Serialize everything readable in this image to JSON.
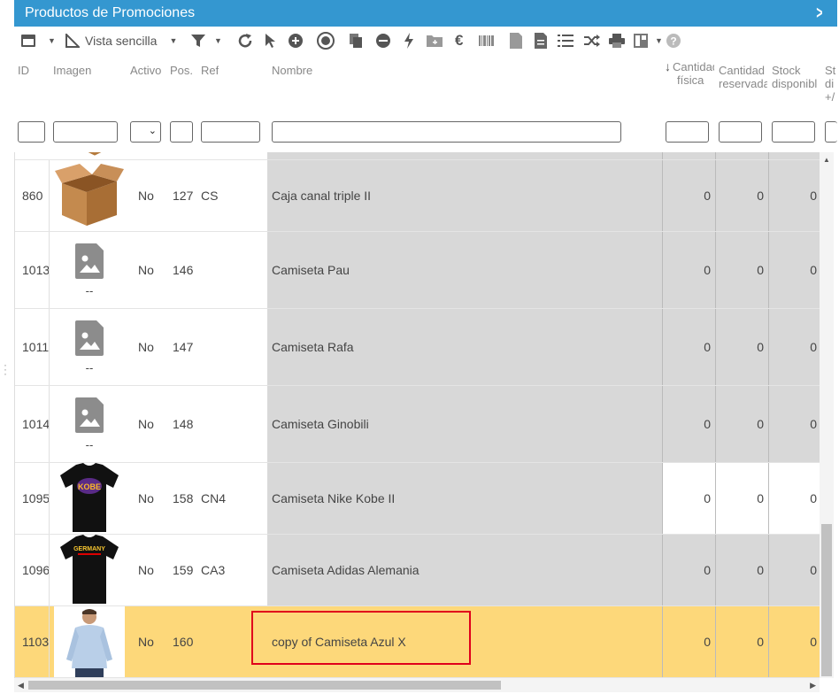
{
  "window": {
    "title": "Productos de Promociones"
  },
  "toolbar": {
    "view_label": "Vista sencilla"
  },
  "columns": {
    "id": "ID",
    "imagen": "Imagen",
    "activo": "Activo",
    "pos": "Pos.",
    "ref": "Ref",
    "nombre": "Nombre",
    "cant_fisica_1": "Cantidad",
    "cant_fisica_2": "física",
    "cant_res_1": "Cantidad",
    "cant_res_2": "reservada",
    "stock_disp_1": "Stock",
    "stock_disp_2": "disponible",
    "stock_x_1": "St",
    "stock_x_2": "di",
    "stock_x_3": "+/"
  },
  "rows": [
    {
      "id": "860",
      "activo": "No",
      "pos": "127",
      "ref": "CS",
      "nombre": "Caja canal triple II",
      "fisica": "0",
      "reservada": "0",
      "disponible": "0",
      "image": "box"
    },
    {
      "id": "1013",
      "activo": "No",
      "pos": "146",
      "ref": "",
      "nombre": "Camiseta Pau",
      "fisica": "0",
      "reservada": "0",
      "disponible": "0",
      "image": "placeholder",
      "image_caption": "--"
    },
    {
      "id": "1011",
      "activo": "No",
      "pos": "147",
      "ref": "",
      "nombre": "Camiseta Rafa",
      "fisica": "0",
      "reservada": "0",
      "disponible": "0",
      "image": "placeholder",
      "image_caption": "--"
    },
    {
      "id": "1014",
      "activo": "No",
      "pos": "148",
      "ref": "",
      "nombre": "Camiseta Ginobili",
      "fisica": "0",
      "reservada": "0",
      "disponible": "0",
      "image": "placeholder",
      "image_caption": "--"
    },
    {
      "id": "1095",
      "activo": "No",
      "pos": "158",
      "ref": "CN4",
      "nombre": "Camiseta Nike Kobe II",
      "fisica": "0",
      "reservada": "0",
      "disponible": "0",
      "image": "tshirt-kobe",
      "image_text": "KOBE"
    },
    {
      "id": "1096",
      "activo": "No",
      "pos": "159",
      "ref": "CA3",
      "nombre": "Camiseta Adidas Alemania",
      "fisica": "0",
      "reservada": "0",
      "disponible": "0",
      "image": "tshirt-germany",
      "image_text": "GERMANY"
    },
    {
      "id": "1103",
      "activo": "No",
      "pos": "160",
      "ref": "",
      "nombre": "copy of Camiseta Azul X",
      "fisica": "0",
      "reservada": "0",
      "disponible": "0",
      "image": "man-shirt",
      "selected": true
    }
  ],
  "colors": {
    "titlebar": "#3497d0",
    "selected_row": "#fdd87a",
    "name_column": "#d8d8d8",
    "highlight_box": "#e0001b"
  }
}
